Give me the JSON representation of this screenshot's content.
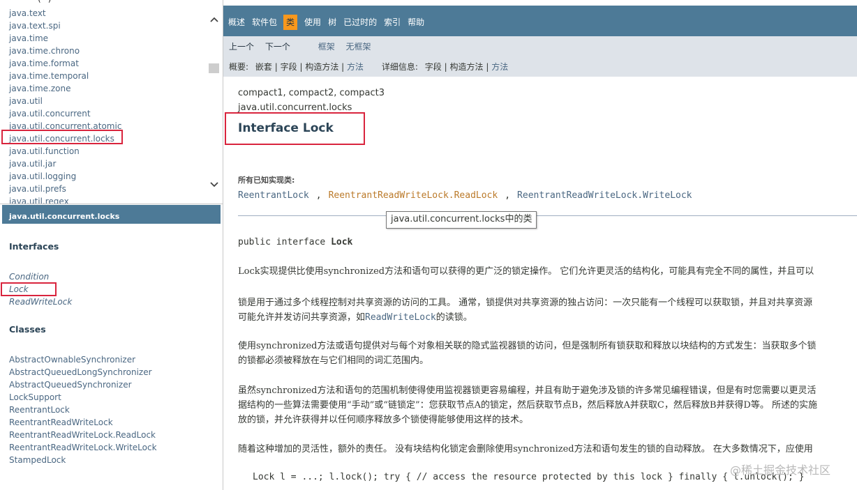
{
  "package_frame": {
    "top_fragment": "~ ~~~(~)",
    "packages": [
      "java.text",
      "java.text.spi",
      "java.time",
      "java.time.chrono",
      "java.time.format",
      "java.time.temporal",
      "java.time.zone",
      "java.util",
      "java.util.concurrent",
      "java.util.concurrent.atomic",
      "java.util.concurrent.locks",
      "java.util.function",
      "java.util.jar",
      "java.util.logging",
      "java.util.prefs",
      "java.util.regex"
    ],
    "scroll_up": "⌃",
    "scroll_down": "⌄"
  },
  "class_frame": {
    "header": "java.util.concurrent.locks",
    "interfaces_heading": "Interfaces",
    "interfaces": [
      "Condition",
      "Lock",
      "ReadWriteLock"
    ],
    "classes_heading": "Classes",
    "classes": [
      "AbstractOwnableSynchronizer",
      "AbstractQueuedLongSynchronizer",
      "AbstractQueuedSynchronizer",
      "LockSupport",
      "ReentrantLock",
      "ReentrantReadWriteLock",
      "ReentrantReadWriteLock.ReadLock",
      "ReentrantReadWriteLock.WriteLock",
      "StampedLock"
    ]
  },
  "topnav": {
    "items": [
      "概述",
      "软件包",
      "类",
      "使用",
      "树",
      "已过时的",
      "索引",
      "帮助"
    ],
    "active_index": 2
  },
  "subnav": {
    "prev": "上一个",
    "next": "下一个",
    "frames": "框架",
    "no_frames": "无框架",
    "summary_label": "概要:",
    "summary_nested": "嵌套",
    "summary_field": "字段",
    "summary_constructor": "构造方法",
    "summary_method": "方法",
    "detail_label": "详细信息:",
    "detail_field": "字段",
    "detail_constructor": "构造方法",
    "detail_method": "方法",
    "sep": "|"
  },
  "content": {
    "profiles": "compact1, compact2, compact3",
    "package": "java.util.concurrent.locks",
    "title": "Interface Lock",
    "impl_label": "所有已知实现类:",
    "impl_classes": [
      "ReentrantLock",
      "ReentrantReadWriteLock.ReadLock",
      "ReentrantReadWriteLock.WriteLock"
    ],
    "impl_sep": ",",
    "tooltip": "java.util.concurrent.locks中的类",
    "decl_prefix": "public interface ",
    "decl_name": "Lock",
    "p1": "Lock实现提供比使用synchronized方法和语句可以获得的更广泛的锁定操作。 它们允许更灵活的结构化，可能具有完全不同的属性，并且可以",
    "p2_line1": "锁是用于通过多个线程控制对共享资源的访问的工具。 通常，锁提供对共享资源的独占访问：一次只能有一个线程可以获取锁，并且对共享资源",
    "p2_line2_a": "可能允许并发访问共享资源，如",
    "p2_line2_link": "ReadWriteLock",
    "p2_line2_b": "的读锁。",
    "p3_line1": "使用synchronized方法或语句提供对与每个对象相关联的隐式监视器锁的访问，但是强制所有锁获取和释放以块结构的方式发生：当获取多个锁",
    "p3_line2": "的锁都必须被释放在与它们相同的词汇范围内。",
    "p4_line1": "虽然synchronized方法和语句的范围机制使得使用监视器锁更容易编程，并且有助于避免涉及锁的许多常见编程错误，但是有时您需要以更灵活",
    "p4_line2": "据结构的一些算法需要使用“手动”或“链锁定”：您获取节点A的锁定，然后获取节点B，然后释放A并获取C，然后释放B并获得D等。 所述的实施",
    "p4_line3": "放的锁，并允许获得并以任何顺序释放多个锁使得能够使用这样的技术。",
    "p5": "随着这种增加的灵活性，额外的责任。 没有块结构化锁定会删除使用synchronized方法和语句发生的锁的自动释放。 在大多数情况下，应使用",
    "code": "Lock l = ...; l.lock(); try { // access the resource protected by this lock } finally { l.unlock(); }"
  },
  "watermark": "@稀土掘金技术社区",
  "colors": {
    "nav_bg": "#4d7a97",
    "subnav_bg": "#dee3e9",
    "active_tab": "#f8981d",
    "link": "#4a6782",
    "highlight_box": "#d9243d"
  }
}
